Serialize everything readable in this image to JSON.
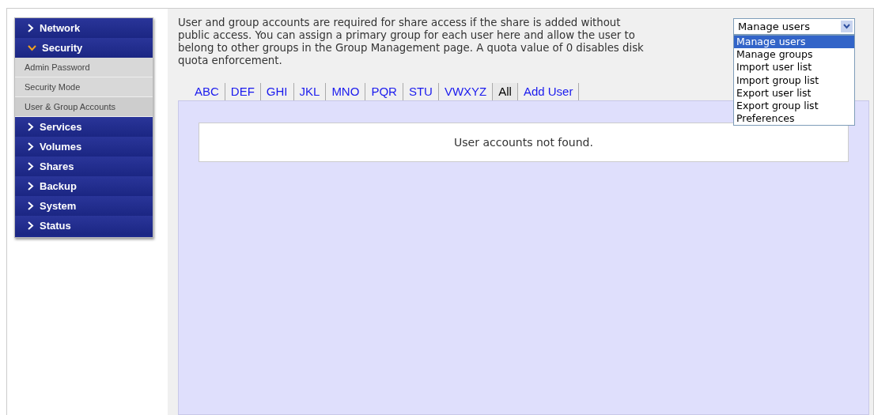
{
  "sidebar": {
    "items": [
      {
        "label": "Network",
        "expanded": false
      },
      {
        "label": "Security",
        "expanded": true,
        "children": [
          {
            "label": "Admin Password",
            "selected": false
          },
          {
            "label": "Security Mode",
            "selected": false
          },
          {
            "label": "User & Group Accounts",
            "selected": true
          }
        ]
      },
      {
        "label": "Services",
        "expanded": false
      },
      {
        "label": "Volumes",
        "expanded": false
      },
      {
        "label": "Shares",
        "expanded": false
      },
      {
        "label": "Backup",
        "expanded": false
      },
      {
        "label": "System",
        "expanded": false
      },
      {
        "label": "Status",
        "expanded": false
      }
    ]
  },
  "description": "User and group accounts are required for share access if the share is added without public access. You can assign a primary group for each user here and allow the user to belong to other groups in the Group Management page. A quota value of 0 disables disk quota enforcement.",
  "action_select": {
    "value": "Manage users",
    "expanded": true,
    "options": [
      {
        "label": "Manage users",
        "selected": true
      },
      {
        "label": "Manage groups",
        "selected": false
      },
      {
        "label": "Import user list",
        "selected": false
      },
      {
        "label": "Import group list",
        "selected": false
      },
      {
        "label": "Export user list",
        "selected": false
      },
      {
        "label": "Export group list",
        "selected": false
      },
      {
        "label": "Preferences",
        "selected": false
      }
    ]
  },
  "tabs": [
    {
      "label": "ABC",
      "selected": false
    },
    {
      "label": "DEF",
      "selected": false
    },
    {
      "label": "GHI",
      "selected": false
    },
    {
      "label": "JKL",
      "selected": false
    },
    {
      "label": "MNO",
      "selected": false
    },
    {
      "label": "PQR",
      "selected": false
    },
    {
      "label": "STU",
      "selected": false
    },
    {
      "label": "VWXYZ",
      "selected": false
    },
    {
      "label": "All",
      "selected": true
    },
    {
      "label": "Add User",
      "selected": false
    }
  ],
  "empty_message": "User accounts not found."
}
